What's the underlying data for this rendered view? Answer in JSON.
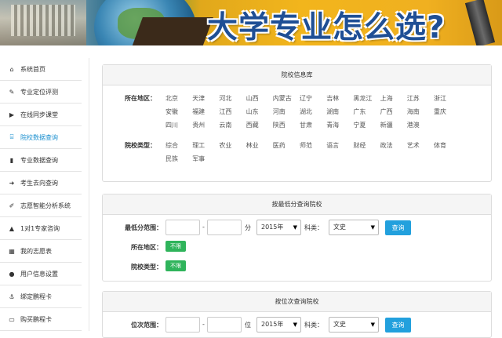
{
  "banner": {
    "title": "大学专业怎么选?"
  },
  "sidebar": {
    "items": [
      {
        "label": "系统首页",
        "icon": "home-icon",
        "glyph": "⌂"
      },
      {
        "label": "专业定位评测",
        "icon": "edit-icon",
        "glyph": "✎"
      },
      {
        "label": "在线同步课堂",
        "icon": "video-icon",
        "glyph": "▶"
      },
      {
        "label": "院校数据查询",
        "icon": "university-icon",
        "glyph": "⌸",
        "active": true
      },
      {
        "label": "专业数据查询",
        "icon": "book-icon",
        "glyph": "▮"
      },
      {
        "label": "考生去向查询",
        "icon": "arrow-right-icon",
        "glyph": "➜"
      },
      {
        "label": "志愿智能分析系统",
        "icon": "pencil-square-icon",
        "glyph": "✐"
      },
      {
        "label": "1对1专家咨询",
        "icon": "graduation-cap-icon",
        "glyph": "▲"
      },
      {
        "label": "我的志愿表",
        "icon": "table-icon",
        "glyph": "▦"
      },
      {
        "label": "用户信息设置",
        "icon": "user-icon",
        "glyph": "●"
      },
      {
        "label": "绑定鹏程卡",
        "icon": "anchor-icon",
        "glyph": "⚓"
      },
      {
        "label": "购买鹏程卡",
        "icon": "credit-card-icon",
        "glyph": "▭"
      }
    ]
  },
  "panel1": {
    "title": "院校信息库",
    "region_label": "所在地区：",
    "regions": [
      "北京",
      "天津",
      "河北",
      "山西",
      "内蒙古",
      "辽宁",
      "吉林",
      "黑龙江",
      "上海",
      "江苏",
      "浙江",
      "安徽",
      "福建",
      "江西",
      "山东",
      "河南",
      "湖北",
      "湖南",
      "广东",
      "广西",
      "海南",
      "重庆",
      "四川",
      "贵州",
      "云南",
      "西藏",
      "陕西",
      "甘肃",
      "青海",
      "宁夏",
      "新疆",
      "港澳"
    ],
    "type_label": "院校类型：",
    "types": [
      "综合",
      "理工",
      "农业",
      "林业",
      "医药",
      "师范",
      "语言",
      "财经",
      "政法",
      "艺术",
      "体育",
      "民族",
      "军事"
    ]
  },
  "panel2": {
    "title": "按最低分查询院校",
    "score_label": "最低分范围：",
    "dash": "-",
    "unit": "分",
    "year": "2015年",
    "subject_label": "科类：",
    "subject": "文史",
    "query": "查询",
    "region_label": "所在地区：",
    "region_value": "不限",
    "type_label": "院校类型：",
    "type_value": "不限"
  },
  "panel3": {
    "title": "按位次查询院校",
    "rank_label": "位次范围：",
    "dash": "-",
    "unit": "位",
    "year": "2015年",
    "subject_label": "科类：",
    "subject": "文史",
    "query": "查询"
  },
  "colors": {
    "accent": "#22a0dd",
    "active_nav": "#1a8fcf",
    "tag_green": "#2fb45b"
  }
}
